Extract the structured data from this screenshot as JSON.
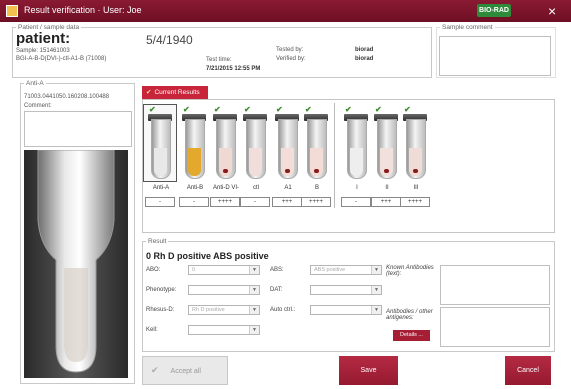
{
  "window": {
    "title": "Result verification · User: Joe",
    "brand": "BIO-RAD",
    "close": "×"
  },
  "patient_group": {
    "legend": "Patient / sample data",
    "name": "patient:",
    "dob": "5/4/1940",
    "sample_line": "Sample:  151461003",
    "card_line": "BGI-A-B-D(DVI-)-ctl-A1-B (71008)",
    "test_time_label": "Test time:",
    "test_time_value": "7/21/2015 12:55 PM",
    "tested_by_label": "Tested by:",
    "tested_by_value": "biorad",
    "verified_by_label": "Verified by:",
    "verified_by_value": "biorad"
  },
  "sample_comment": {
    "legend": "Sample comment"
  },
  "card_group": {
    "legend": "Anti-A",
    "barcode": "71003.0441050.160208.100488",
    "comment_label": "Comment:"
  },
  "tabs": {
    "current": "Current Results"
  },
  "tubes": [
    {
      "label": "Anti-A",
      "value": "-",
      "color": "#e8e8e8"
    },
    {
      "label": "Anti-B",
      "value": "-",
      "color": "#e3a92c"
    },
    {
      "label": "Anti-D VI-",
      "value": "++++",
      "color": "#f0d9d2"
    },
    {
      "label": "ctl",
      "value": "-",
      "color": "#f1dedb"
    },
    {
      "label": "A1",
      "value": "+++",
      "color": "#f2ddd8"
    },
    {
      "label": "B",
      "value": "++++",
      "color": "#f3dcd6"
    },
    {
      "label": "I",
      "value": "-",
      "color": "#eeeeee"
    },
    {
      "label": "II",
      "value": "+++",
      "color": "#f1e1dd"
    },
    {
      "label": "III",
      "value": "++++",
      "color": "#f0dcd6"
    }
  ],
  "result": {
    "legend": "Result",
    "title": "0 Rh D positive  ABS positive",
    "abo_label": "ABO:",
    "abo_value": "0",
    "abs_label": "ABS:",
    "abs_value": "ABS positive",
    "phenotype_label": "Phenotype:",
    "dat_label": "DAT:",
    "rhesus_label": "Rhesus-D:",
    "rhesus_value": "Rh D positive",
    "autoctrl_label": "Auto ctrl.:",
    "kell_label": "Kell:",
    "known_label": "Known Antibodies (text):",
    "other_label": "Antibodies / other antigenes:",
    "details_button": "Details ..."
  },
  "buttons": {
    "accept": "Accept all",
    "save": "Save",
    "cancel": "Cancel"
  }
}
